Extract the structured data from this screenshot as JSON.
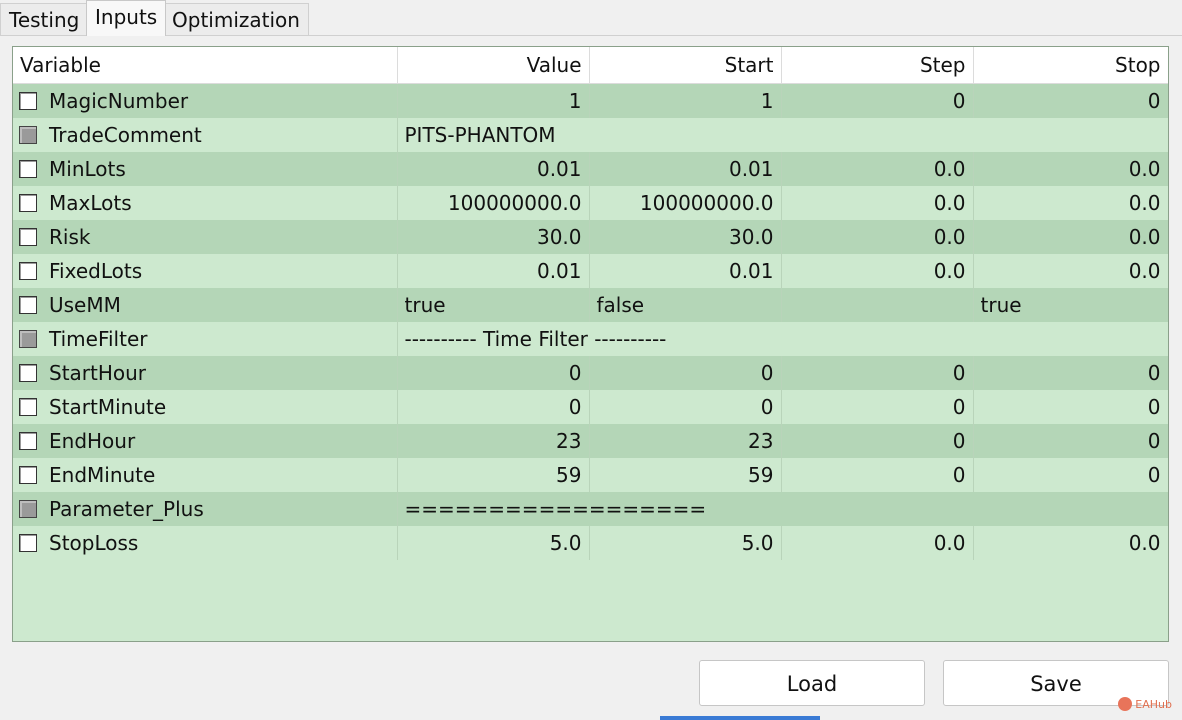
{
  "tabs": [
    {
      "label": "Testing",
      "active": false
    },
    {
      "label": "Inputs",
      "active": true
    },
    {
      "label": "Optimization",
      "active": false
    }
  ],
  "grid": {
    "columns": [
      "Variable",
      "Value",
      "Start",
      "Step",
      "Stop"
    ],
    "rows": [
      {
        "name": "MagicNumber",
        "checkbox": "white",
        "value": "1",
        "start": "1",
        "step": "0",
        "stop": "0"
      },
      {
        "name": "TradeComment",
        "checkbox": "gray",
        "value": "PITS-PHANTOM",
        "start": "",
        "step": "",
        "stop": "",
        "text": true
      },
      {
        "name": "MinLots",
        "checkbox": "white",
        "value": "0.01",
        "start": "0.01",
        "step": "0.0",
        "stop": "0.0"
      },
      {
        "name": "MaxLots",
        "checkbox": "white",
        "value": "100000000.0",
        "start": "100000000.0",
        "step": "0.0",
        "stop": "0.0"
      },
      {
        "name": "Risk",
        "checkbox": "white",
        "value": "30.0",
        "start": "30.0",
        "step": "0.0",
        "stop": "0.0"
      },
      {
        "name": "FixedLots",
        "checkbox": "white",
        "value": "0.01",
        "start": "0.01",
        "step": "0.0",
        "stop": "0.0"
      },
      {
        "name": "UseMM",
        "checkbox": "white",
        "value": "true",
        "start": "false",
        "step": "",
        "stop": "true",
        "bool": true
      },
      {
        "name": "TimeFilter",
        "checkbox": "gray",
        "value": "---------- Time Filter ----------",
        "start": "",
        "step": "",
        "stop": "",
        "text": true
      },
      {
        "name": "StartHour",
        "checkbox": "white",
        "value": "0",
        "start": "0",
        "step": "0",
        "stop": "0"
      },
      {
        "name": "StartMinute",
        "checkbox": "white",
        "value": "0",
        "start": "0",
        "step": "0",
        "stop": "0"
      },
      {
        "name": "EndHour",
        "checkbox": "white",
        "value": "23",
        "start": "23",
        "step": "0",
        "stop": "0"
      },
      {
        "name": "EndMinute",
        "checkbox": "white",
        "value": "59",
        "start": "59",
        "step": "0",
        "stop": "0"
      },
      {
        "name": "Parameter_Plus",
        "checkbox": "gray",
        "value": "==================",
        "start": "",
        "step": "",
        "stop": "",
        "text": true
      },
      {
        "name": "StopLoss",
        "checkbox": "white",
        "value": "5.0",
        "start": "5.0",
        "step": "0.0",
        "stop": "0.0"
      }
    ]
  },
  "buttons": {
    "load": "Load",
    "save": "Save"
  },
  "watermark": "EAHub",
  "colors": {
    "row_dark": "#b4d6b7",
    "row_light": "#cde9cf",
    "accent": "#3a7bd5"
  }
}
